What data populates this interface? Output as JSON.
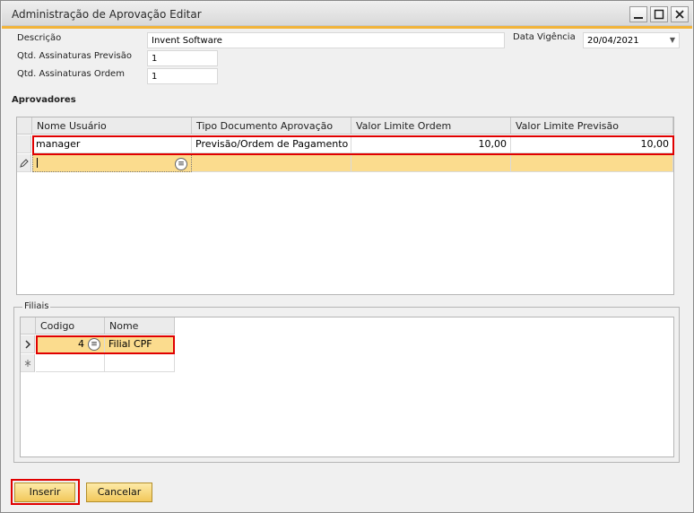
{
  "window": {
    "title": "Administração de Aprovação Editar"
  },
  "header_fields": {
    "descricao_label": "Descrição",
    "descricao_value": "Invent Software",
    "qtd_previsao_label": "Qtd. Assinaturas Previsão",
    "qtd_previsao_value": "1",
    "qtd_ordem_label": "Qtd. Assinaturas Ordem",
    "qtd_ordem_value": "1",
    "data_vigencia_label": "Data Vigência",
    "data_vigencia_value": "20/04/2021"
  },
  "aprovadores": {
    "title": "Aprovadores",
    "columns": [
      "Nome Usuário",
      "Tipo Documento Aprovação",
      "Valor Limite Ordem",
      "Valor Limite Previsão"
    ],
    "rows": [
      [
        "manager",
        "Previsão/Ordem de Pagamento",
        "10,00",
        "10,00"
      ]
    ]
  },
  "filiais": {
    "title": "Filiais",
    "columns": [
      "Codigo",
      "Nome"
    ],
    "rows": [
      [
        "4",
        "Filial CPF"
      ]
    ]
  },
  "buttons": {
    "inserir": "Inserir",
    "cancelar": "Cancelar"
  },
  "colors": {
    "accent": "#f2b43a",
    "highlight_row": "#fbdc8e",
    "annotation_red": "#e00000"
  }
}
